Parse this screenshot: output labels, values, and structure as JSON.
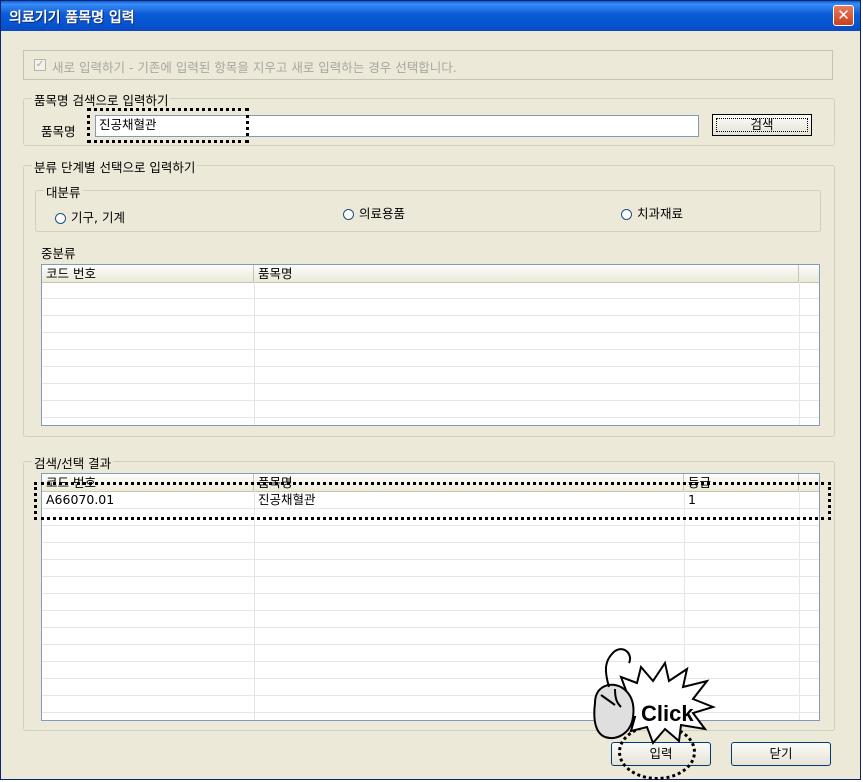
{
  "window": {
    "title": "의료기기 품목명 입력",
    "close_glyph": "✕"
  },
  "new_entry": {
    "checked": true,
    "label": "새로 입력하기 - 기존에 입력된 항목을 지우고 새로 입력하는 경우 선택합니다."
  },
  "search_section": {
    "legend": "품목명 검색으로 입력하기",
    "field_label": "품목명",
    "value": "진공채혈관",
    "search_button": "검색"
  },
  "category_section": {
    "legend": "분류 단계별 선택으로 입력하기",
    "major": {
      "legend": "대분류",
      "options": [
        "기구, 기계",
        "의료용품",
        "치과재료"
      ]
    },
    "middle": {
      "label": "중분류",
      "columns": [
        "코드 번호",
        "품목명"
      ],
      "rows": []
    }
  },
  "results_section": {
    "legend": "검색/선택 결과",
    "columns": [
      "코드 번호",
      "품목명",
      "등급"
    ],
    "rows": [
      {
        "code": "A66070.01",
        "name": "진공채혈관",
        "grade": "1"
      }
    ]
  },
  "annotation": {
    "callout_text": "Click"
  },
  "buttons": {
    "input": "입력",
    "close": "닫기"
  }
}
